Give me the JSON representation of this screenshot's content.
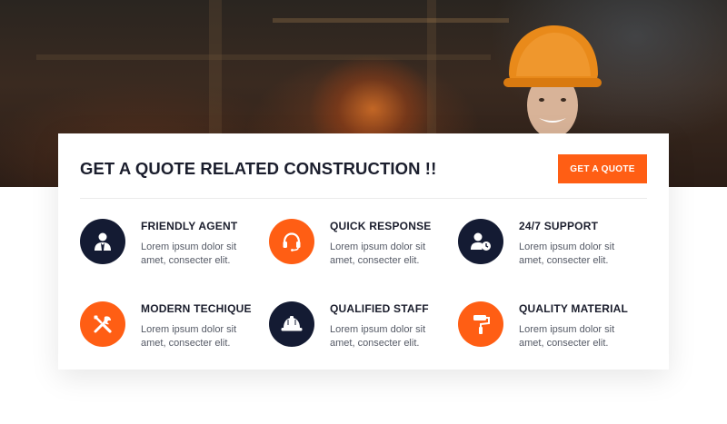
{
  "card": {
    "title": "GET A QUOTE RELATED CONSTRUCTION !!",
    "button_label": "GET A QUOTE"
  },
  "features": [
    {
      "title": "FRIENDLY AGENT",
      "description": "Lorem ipsum dolor sit amet, consecter elit.",
      "icon": "agent-icon",
      "color": "#141b33"
    },
    {
      "title": "QUICK RESPONSE",
      "description": "Lorem ipsum dolor sit amet, consecter elit.",
      "icon": "headset-icon",
      "color": "#ff5e14"
    },
    {
      "title": "24/7 SUPPORT",
      "description": "Lorem ipsum dolor sit amet, consecter elit.",
      "icon": "user-clock-icon",
      "color": "#141b33"
    },
    {
      "title": "MODERN TECHIQUE",
      "description": "Lorem ipsum dolor sit amet, consecter elit.",
      "icon": "tools-icon",
      "color": "#ff5e14"
    },
    {
      "title": "QUALIFIED STAFF",
      "description": "Lorem ipsum dolor sit amet, consecter elit.",
      "icon": "hard-hat-icon",
      "color": "#141b33"
    },
    {
      "title": "QUALITY MATERIAL",
      "description": "Lorem ipsum dolor sit amet, consecter elit.",
      "icon": "paint-roller-icon",
      "color": "#ff5e14"
    }
  ],
  "colors": {
    "accent": "#ff5e14",
    "navy": "#141b33",
    "heading": "#1b1e2d"
  }
}
